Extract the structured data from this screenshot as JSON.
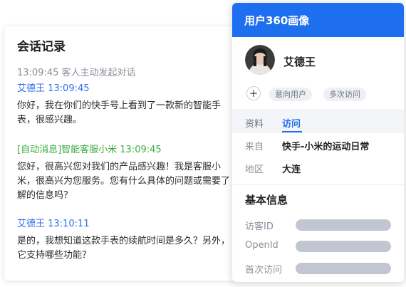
{
  "chat": {
    "title": "会话记录",
    "system_line": "13:09:45 客人主动发起对话",
    "messages": [
      {
        "sender_line": "艾德王 13:09:45",
        "text": "你好，我在你们的快手号上看到了一款新的智能手表，很感兴趣。"
      },
      {
        "sender_line": "[自动消息]智能客服小米 13:09:45",
        "text": "您好，很高兴您对我们的产品感兴趣！我是客服小米，很高兴为您服务。您有什么具体的问题或需要了解的信息吗？"
      },
      {
        "sender_line": "艾德王 13:10:11",
        "text": "是的，我想知道这款手表的续航时间是多久？另外，它支持哪些功能？"
      }
    ]
  },
  "profile": {
    "header_title": "用户360画像",
    "user_name": "艾德王",
    "add_tag_symbol": "+",
    "tags": [
      "意向用户",
      "多次访问"
    ],
    "tabs": [
      "资料",
      "访问"
    ],
    "active_tab": "访问",
    "visit": {
      "source_label": "来自",
      "source_value": "快手-小米的运动日常",
      "region_label": "地区",
      "region_value": "大连"
    },
    "basic_info": {
      "title": "基本信息",
      "fields": [
        "访客ID",
        "OpenId",
        "首次访问"
      ]
    }
  },
  "colors": {
    "accent": "#1e6ff0",
    "user_name_blue": "#2f6ff0",
    "bot_green": "#3cad42",
    "muted_text": "#8a8f99",
    "placeholder_bar": "#c2c6d0"
  }
}
